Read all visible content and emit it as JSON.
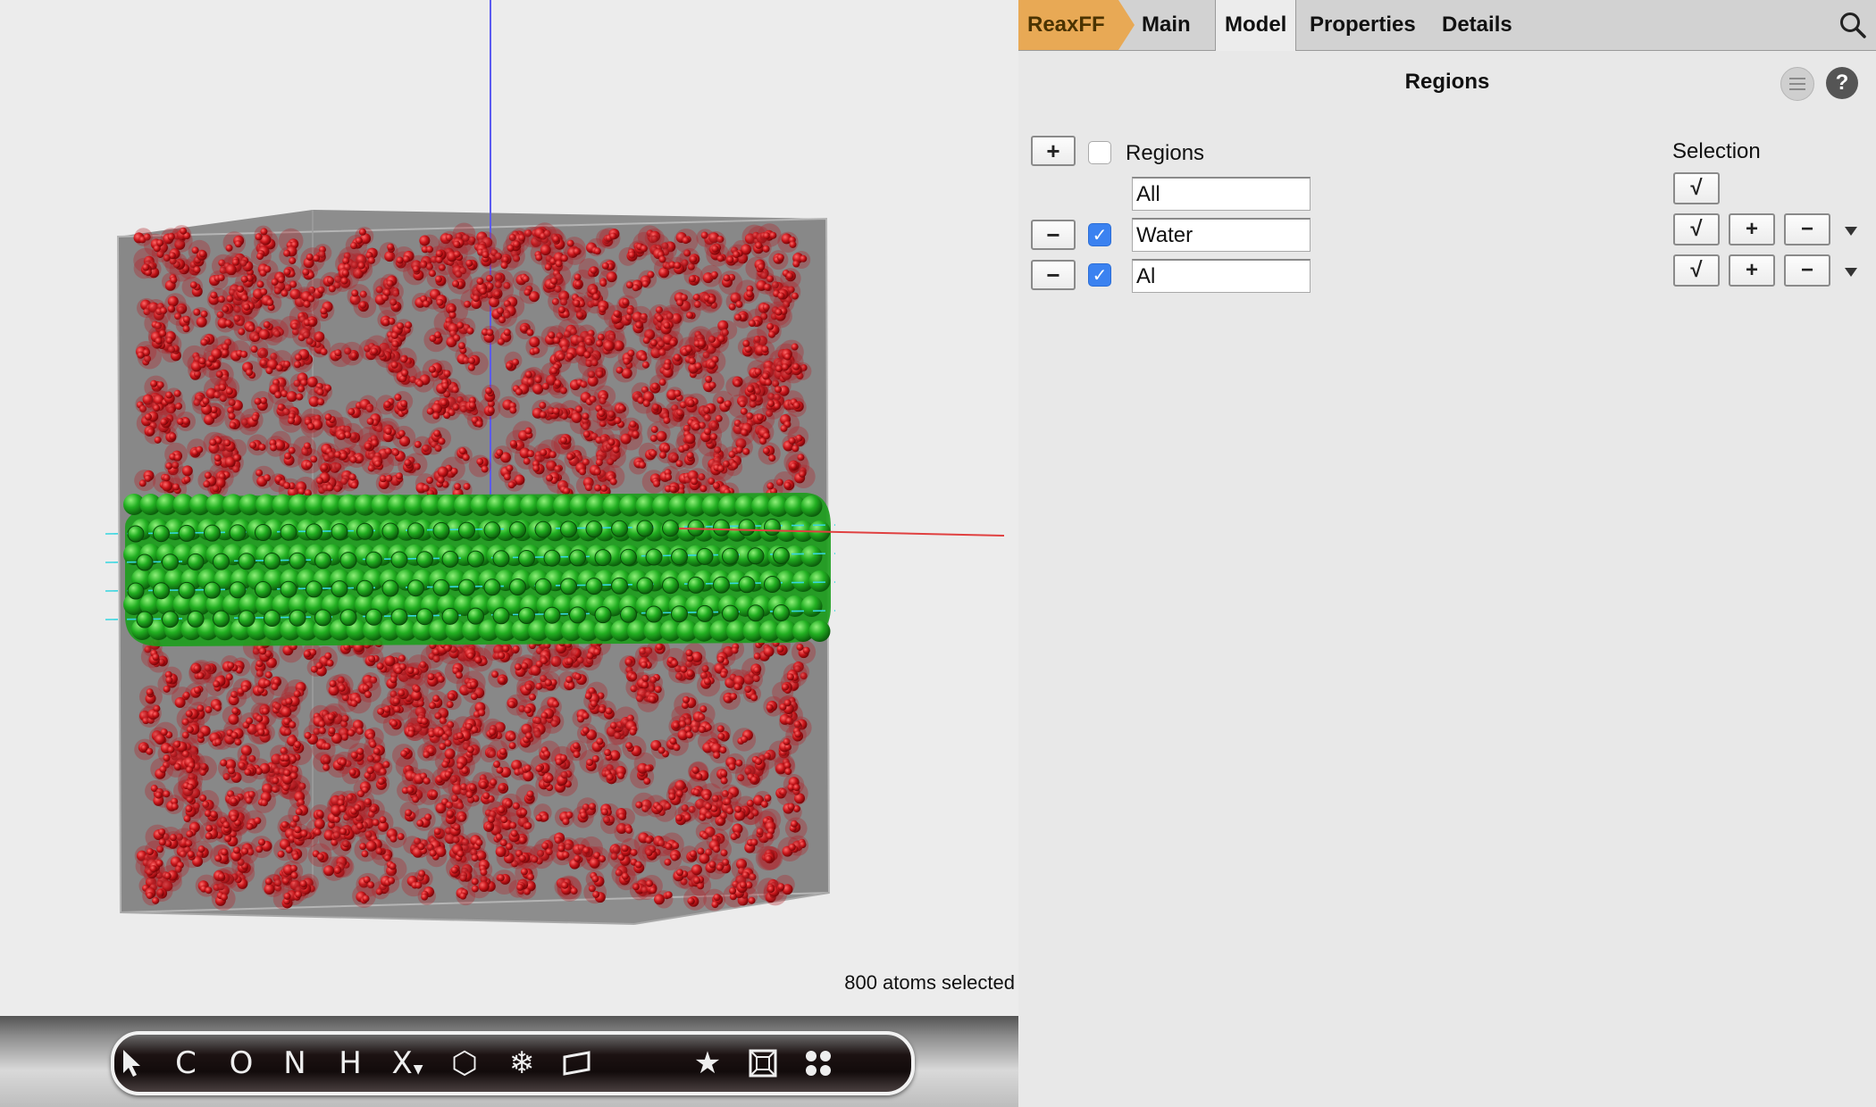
{
  "status": {
    "selection_text": "800 atoms selected"
  },
  "toolbar": {
    "tools": [
      {
        "name": "select",
        "glyph": ""
      },
      {
        "name": "carbon",
        "glyph": "C"
      },
      {
        "name": "oxygen",
        "glyph": "O"
      },
      {
        "name": "nitrogen",
        "glyph": "N"
      },
      {
        "name": "hydrogen",
        "glyph": "H"
      },
      {
        "name": "other-element",
        "glyph": "X"
      },
      {
        "name": "ring",
        "glyph": "⬡"
      },
      {
        "name": "freeze",
        "glyph": "❄"
      },
      {
        "name": "plane",
        "glyph": ""
      },
      {
        "name": "favorites",
        "glyph": "★"
      },
      {
        "name": "box",
        "glyph": ""
      },
      {
        "name": "fragments",
        "glyph": ""
      }
    ],
    "icons": [
      "cursor-arrow-icon",
      "carbon-icon",
      "oxygen-icon",
      "nitrogen-icon",
      "hydrogen-icon",
      "element-x-icon",
      "hexagon-icon",
      "snowflake-icon",
      "plane-icon",
      "star-icon",
      "box-icon",
      "dots-icon"
    ]
  },
  "tabs": {
    "reaxff": "ReaxFF",
    "main": "Main",
    "model": "Model",
    "properties": "Properties",
    "details": "Details"
  },
  "panel": {
    "title": "Regions",
    "header_label": "Regions",
    "selection_label": "Selection",
    "add_symbol": "+",
    "remove_symbol": "−",
    "check_symbol": "√",
    "regions": [
      {
        "name": "All",
        "checked": null
      },
      {
        "name": "Water",
        "checked": true
      },
      {
        "name": "Al",
        "checked": true
      }
    ]
  },
  "colors": {
    "accent_tab": "#e8a955",
    "checkbox_on": "#3b82f0",
    "water_atoms": "#c0161a",
    "al_atoms": "#1fa81f",
    "cell_box": "#8a8a8a"
  }
}
